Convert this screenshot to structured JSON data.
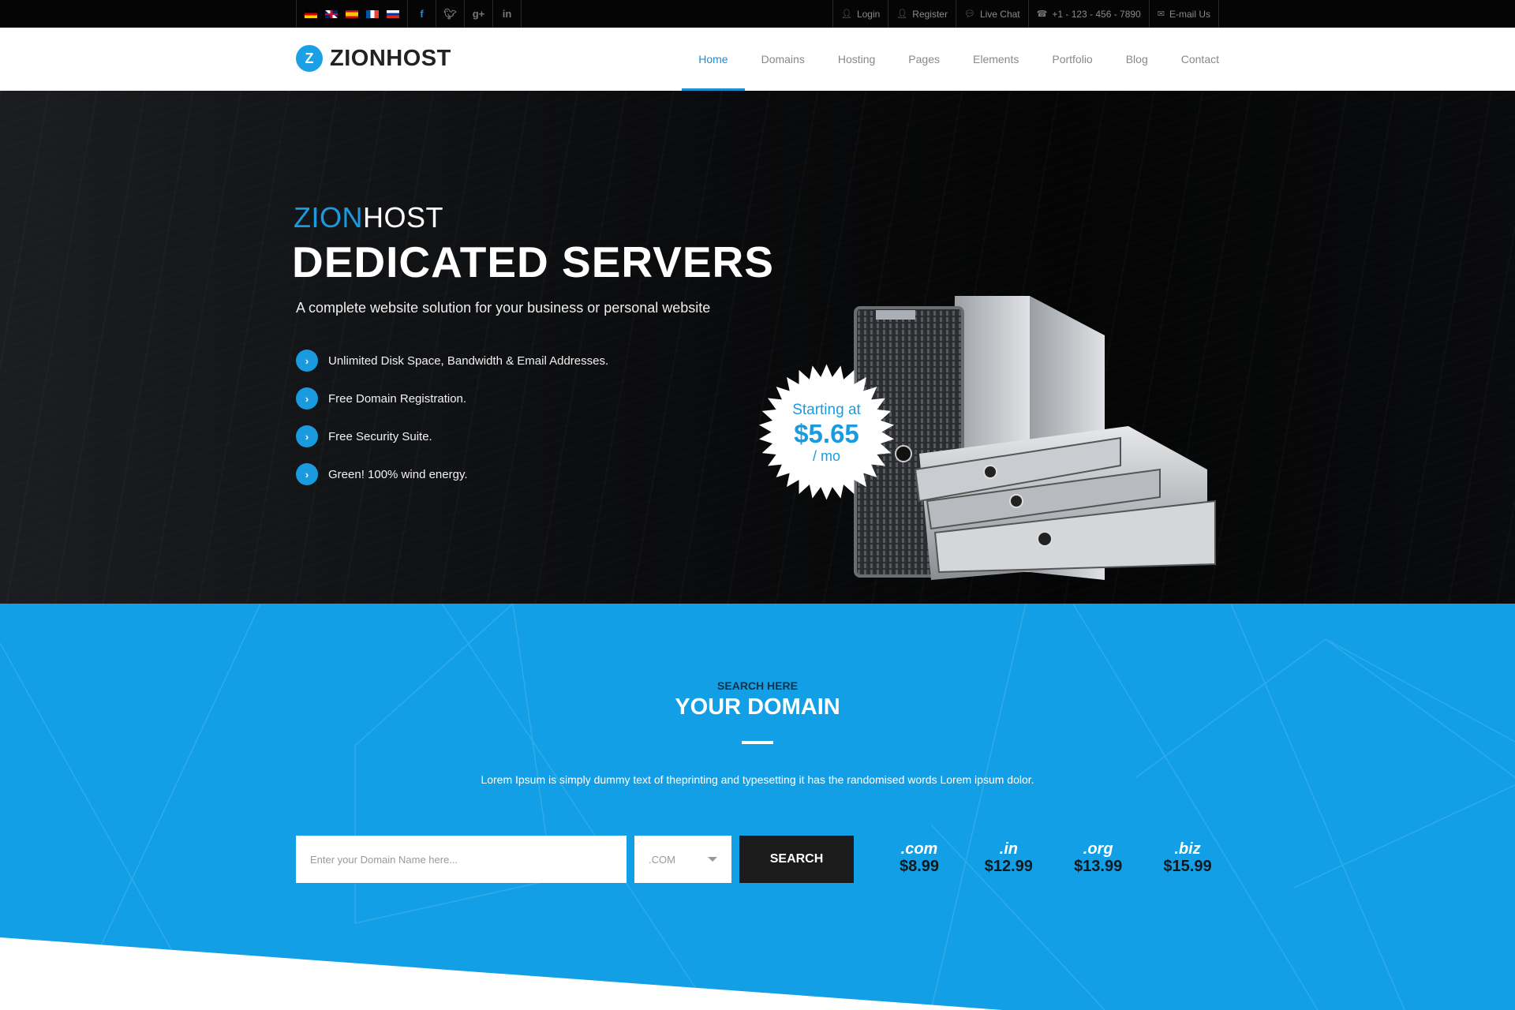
{
  "topbar": {
    "flags": [
      {
        "name": "german",
        "colors": [
          "#000000",
          "#dd0000",
          "#ffce00"
        ]
      },
      {
        "name": "english",
        "colors": [
          "#012169",
          "#ffffff",
          "#c8102e"
        ]
      },
      {
        "name": "spanish",
        "colors": [
          "#c60b1e",
          "#ffc400",
          "#c60b1e"
        ]
      },
      {
        "name": "french",
        "colors": [
          "#0055a4",
          "#ffffff",
          "#ef4135"
        ]
      },
      {
        "name": "russian",
        "colors": [
          "#ffffff",
          "#0039a6",
          "#d52b1e"
        ]
      }
    ],
    "social": [
      {
        "name": "facebook",
        "glyph": "f",
        "color": "#1a8fd3"
      },
      {
        "name": "twitter",
        "glyph": "🐦︎",
        "color": "#777777"
      },
      {
        "name": "google-plus",
        "glyph": "g+",
        "color": "#777777"
      },
      {
        "name": "linkedin",
        "glyph": "in",
        "color": "#777777"
      }
    ],
    "links": [
      {
        "label": "Login",
        "icon": "👤︎"
      },
      {
        "label": "Register",
        "icon": "👤︎"
      },
      {
        "label": "Live Chat",
        "icon": "💬︎"
      },
      {
        "label": "+1 - 123 - 456 - 7890",
        "icon": "☎"
      },
      {
        "label": "E-mail Us",
        "icon": "✉"
      }
    ]
  },
  "header": {
    "logo_mark": "Z",
    "logo_text": "ZIONHOST",
    "nav": [
      "Home",
      "Domains",
      "Hosting",
      "Pages",
      "Elements",
      "Portfolio",
      "Blog",
      "Contact"
    ],
    "active_nav": "Home"
  },
  "hero": {
    "sub_accent": "ZION",
    "sub_rest": "HOST",
    "title": "DEDICATED SERVERS",
    "description": "A complete website solution for your business or personal website",
    "features": [
      "Unlimited Disk Space, Bandwidth & Email Addresses.",
      "Free Domain Registration.",
      "Free Security Suite.",
      "Green! 100% wind energy."
    ],
    "badge": {
      "starting": "Starting at",
      "price": "$5.65",
      "period": "/ mo"
    }
  },
  "domain": {
    "kicker": "SEARCH HERE",
    "title": "YOUR DOMAIN",
    "description": "Lorem Ipsum is simply dummy text of theprinting and typesetting it has the randomised words Lorem ipsum dolor.",
    "input_placeholder": "Enter your Domain Name here...",
    "input_value": "",
    "tld_selected": ".COM",
    "search_label": "SEARCH",
    "prices": [
      {
        "tld": ".com",
        "price": "$8.99"
      },
      {
        "tld": ".in",
        "price": "$12.99"
      },
      {
        "tld": ".org",
        "price": "$13.99"
      },
      {
        "tld": ".biz",
        "price": "$15.99"
      }
    ]
  },
  "colors": {
    "accent": "#1a9be0",
    "section_blue": "#139fe5",
    "topbar": "#050505",
    "dark_button": "#1b1b1b"
  }
}
